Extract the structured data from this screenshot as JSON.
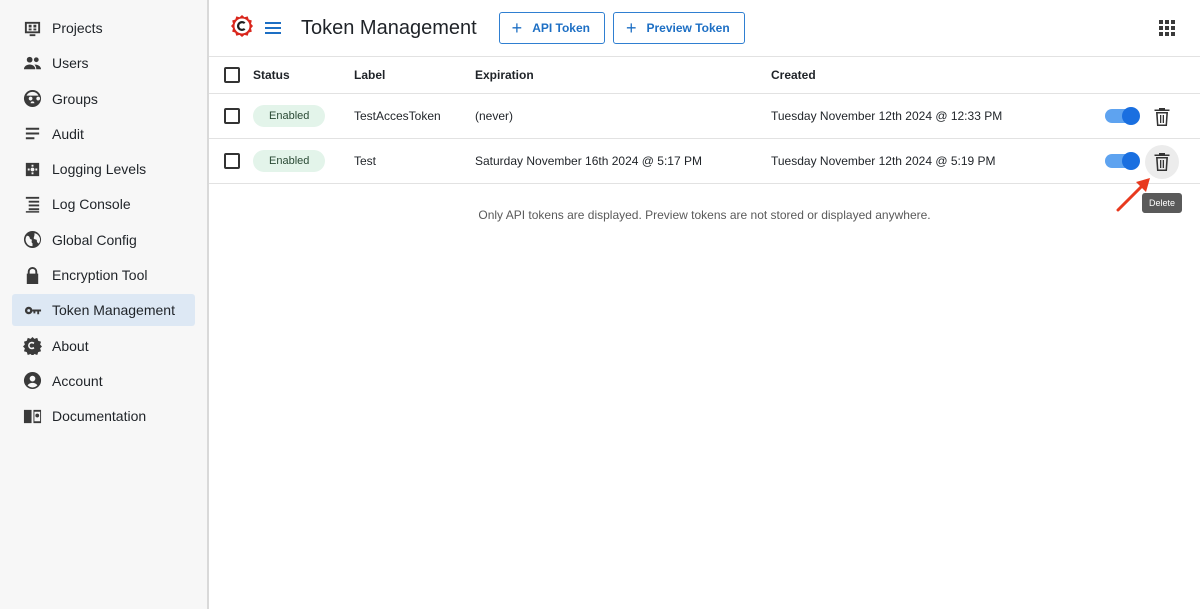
{
  "sidebar": {
    "items": [
      {
        "label": "Projects",
        "icon": "projects-icon"
      },
      {
        "label": "Users",
        "icon": "users-icon"
      },
      {
        "label": "Groups",
        "icon": "groups-icon"
      },
      {
        "label": "Audit",
        "icon": "audit-icon"
      },
      {
        "label": "Logging Levels",
        "icon": "logging-levels-icon"
      },
      {
        "label": "Log Console",
        "icon": "log-console-icon"
      },
      {
        "label": "Global Config",
        "icon": "globe-icon"
      },
      {
        "label": "Encryption Tool",
        "icon": "lock-icon"
      },
      {
        "label": "Token Management",
        "icon": "key-icon",
        "active": true
      },
      {
        "label": "About",
        "icon": "about-logo-icon"
      },
      {
        "label": "Account",
        "icon": "account-icon"
      },
      {
        "label": "Documentation",
        "icon": "documentation-icon"
      }
    ]
  },
  "header": {
    "title": "Token Management",
    "api_token_label": "API Token",
    "preview_token_label": "Preview Token"
  },
  "table": {
    "columns": [
      "Status",
      "Label",
      "Expiration",
      "Created"
    ],
    "rows": [
      {
        "status": "Enabled",
        "label": "TestAccesToken",
        "expiration": "(never)",
        "created": "Tuesday November 12th 2024 @ 12:33 PM",
        "enabled": true
      },
      {
        "status": "Enabled",
        "label": "Test",
        "expiration": "Saturday November 16th 2024 @ 5:17 PM",
        "created": "Tuesday November 12th 2024 @ 5:19 PM",
        "enabled": true
      }
    ]
  },
  "footnote": "Only API tokens are displayed. Preview tokens are not stored or displayed anywhere.",
  "tooltip": "Delete",
  "colors": {
    "accent": "#1a6fe0",
    "badge_bg": "#e3f4ea",
    "annotation_arrow": "#e8391e",
    "logo_red": "#d9261c"
  }
}
